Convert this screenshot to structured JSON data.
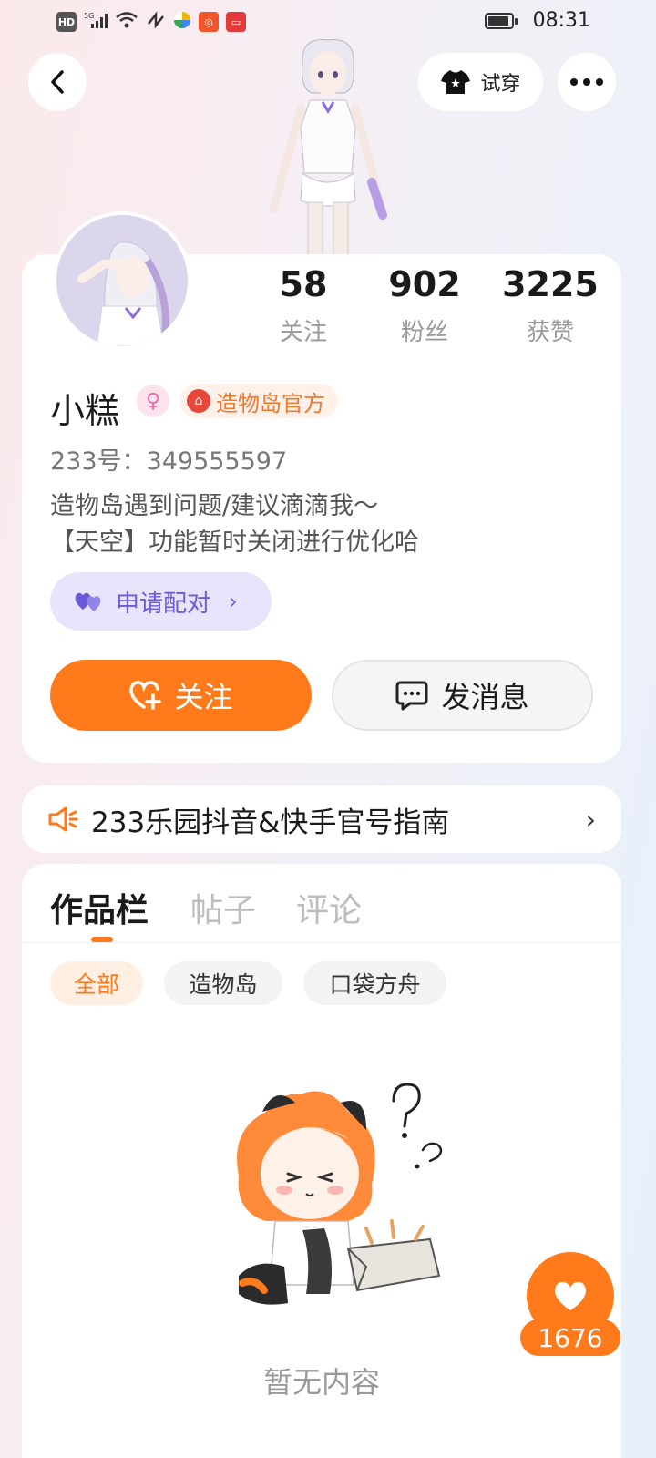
{
  "status_bar": {
    "time": "08:31",
    "icons": [
      "hd-icon",
      "signal-5g-icon",
      "wifi-icon",
      "nfc-icon",
      "app-pinwheel-icon",
      "app-orange-icon",
      "app-red-icon"
    ],
    "battery_level": 0.9
  },
  "header": {
    "tryon_label": "试穿"
  },
  "profile": {
    "name": "小糕",
    "official_badge": "造物岛官方",
    "id_line": "233号：349555597",
    "bio_line1": "造物岛遇到问题/建议滴滴我～",
    "bio_line2": "【天空】功能暂时关闭进行优化哈",
    "pair_label": "申请配对",
    "stats": {
      "following": {
        "value": "58",
        "label": "关注"
      },
      "fans": {
        "value": "902",
        "label": "粉丝"
      },
      "likes": {
        "value": "3225",
        "label": "获赞"
      }
    },
    "follow_label": "关注",
    "message_label": "发消息"
  },
  "banner": {
    "text": "233乐园抖音&快手官号指南"
  },
  "tabs": {
    "items": [
      "作品栏",
      "帖子",
      "评论"
    ],
    "active": 0,
    "chips": [
      "全部",
      "造物岛",
      "口袋方舟"
    ],
    "active_chip": 0
  },
  "empty": {
    "text": "暂无内容"
  },
  "like_fab": {
    "count": "1676"
  },
  "colors": {
    "accent": "#ff7a1a",
    "pair_bg": "#e7e4fb",
    "pair_text": "#6a5bd7"
  }
}
